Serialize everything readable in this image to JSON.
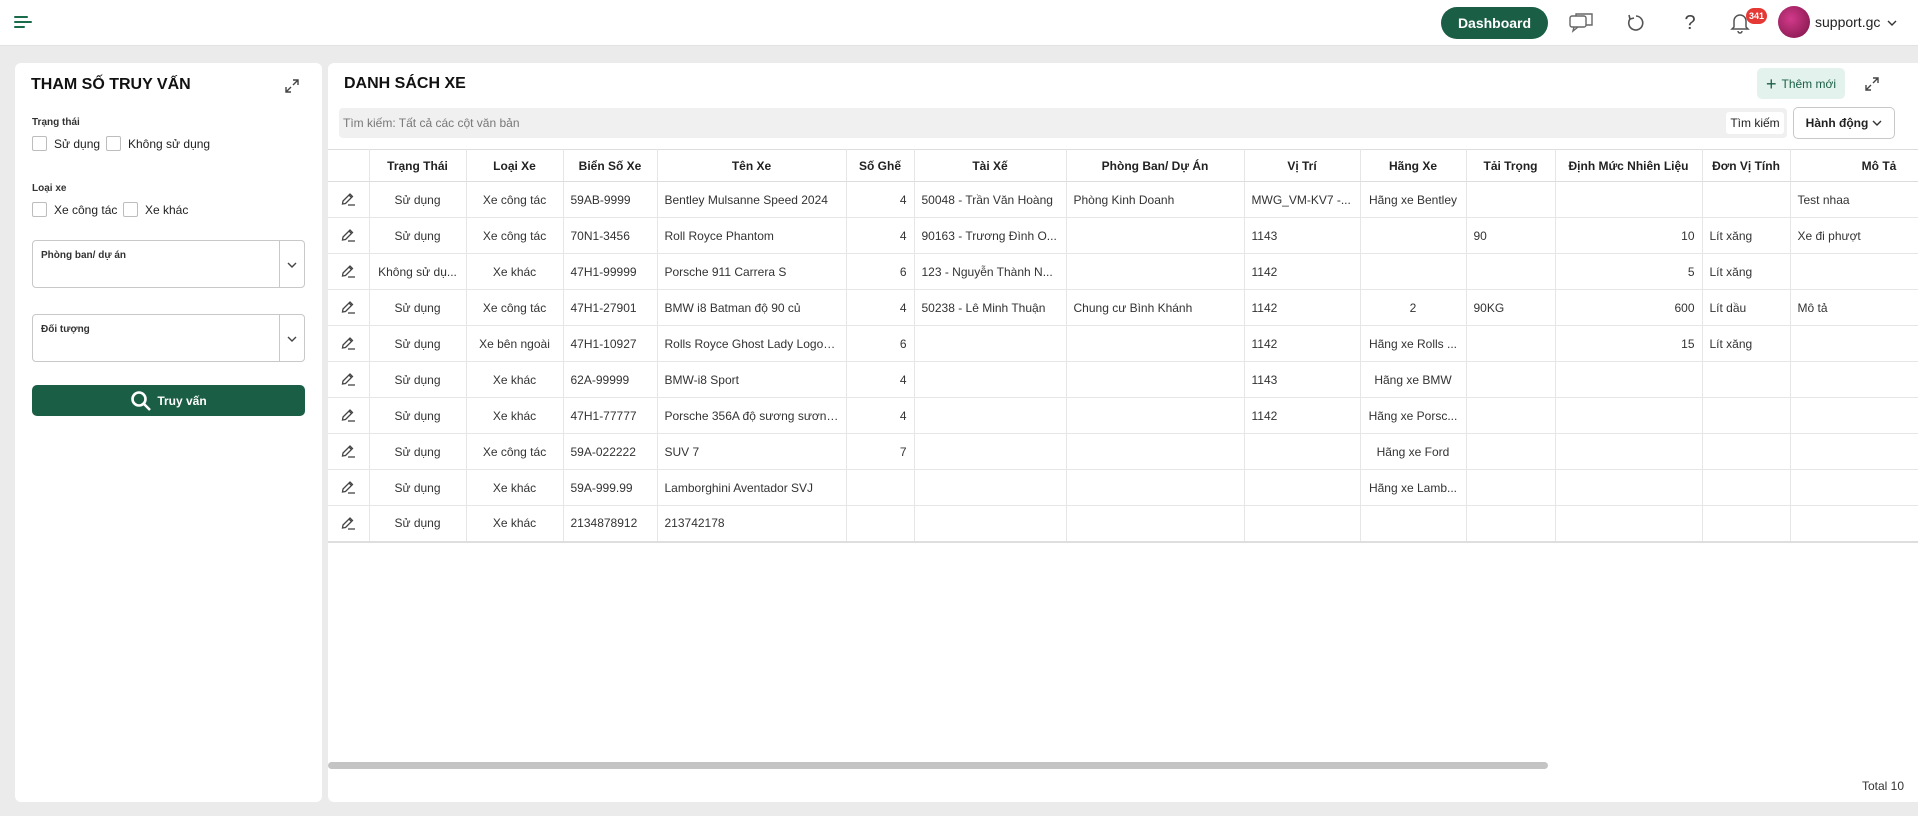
{
  "topbar": {
    "dashboard_label": "Dashboard",
    "notification_count": "341",
    "user_name": "support.gc"
  },
  "query_panel": {
    "title": "THAM SỐ TRUY VẤN",
    "status_label": "Trạng thái",
    "status_options": [
      "Sử dụng",
      "Không sử dụng"
    ],
    "type_label": "Loại xe",
    "type_options": [
      "Xe công tác",
      "Xe khác"
    ],
    "department_label": "Phòng ban/ dự án",
    "object_label": "Đối tượng",
    "query_button": "Truy vấn"
  },
  "list_panel": {
    "title": "DANH SÁCH XE",
    "add_button": "Thêm mới",
    "search_placeholder": "Tìm kiếm: Tất cả các cột văn bản",
    "search_button": "Tìm kiếm",
    "action_button": "Hành động",
    "total_label": "Total 10"
  },
  "table": {
    "columns": [
      "",
      "Trạng Thái",
      "Loại Xe",
      "Biển Số Xe",
      "Tên Xe",
      "Số Ghế",
      "Tài Xế",
      "Phòng Ban/ Dự Án",
      "Vị Trí",
      "Hãng Xe",
      "Tải Trọng",
      "Định Mức Nhiên Liệu",
      "Đơn Vị Tính",
      "Mô Tả"
    ],
    "rows": [
      [
        "Sử dụng",
        "Xe công tác",
        "59AB-9999",
        "Bentley Mulsanne Speed 2024",
        "4",
        "50048 - Trần Văn Hoàng",
        "Phòng Kinh Doanh",
        "MWG_VM-KV7 -...",
        "Hãng xe Bentley",
        "",
        "",
        "",
        "Test nhaa"
      ],
      [
        "Sử dụng",
        "Xe công tác",
        "70N1-3456",
        "Roll Royce Phantom",
        "4",
        "90163 - Trương Đình O...",
        "",
        "1143",
        "",
        "90",
        "10",
        "Lít xăng",
        "Xe đi phượt"
      ],
      [
        "Không sử dụ...",
        "Xe khác",
        "47H1-99999",
        "Porsche 911 Carrera S",
        "6",
        "123 - Nguyễn Thành N...",
        "",
        "1142",
        "",
        "",
        "5",
        "Lít xăng",
        ""
      ],
      [
        "Sử dụng",
        "Xe công tác",
        "47H1-27901",
        "BMW i8 Batman độ 90 củ",
        "4",
        "50238 - Lê Minh Thuận",
        "Chung cư Bình Khánh",
        "1142",
        "2",
        "90KG",
        "600",
        "Lít dầu",
        "Mô tả"
      ],
      [
        "Sử dụng",
        "Xe bên ngoài",
        "47H1-10927",
        "Rolls Royce Ghost Lady Logo Li...",
        "6",
        "",
        "",
        "1142",
        "Hãng xe Rolls ...",
        "",
        "15",
        "Lít xăng",
        ""
      ],
      [
        "Sử dụng",
        "Xe khác",
        "62A-99999",
        "BMW-i8 Sport",
        "4",
        "",
        "",
        "1143",
        "Hãng xe BMW",
        "",
        "",
        "",
        ""
      ],
      [
        "Sử dụng",
        "Xe khác",
        "47H1-77777",
        "Porsche 356A độ sương sương...",
        "4",
        "",
        "",
        "1142",
        "Hãng xe Porsc...",
        "",
        "",
        "",
        ""
      ],
      [
        "Sử dụng",
        "Xe công tác",
        "59A-022222",
        "SUV 7",
        "7",
        "",
        "",
        "",
        "Hãng xe Ford",
        "",
        "",
        "",
        ""
      ],
      [
        "Sử dụng",
        "Xe khác",
        "59A-999.99",
        "Lamborghini Aventador SVJ",
        "",
        "",
        "",
        "",
        "Hãng xe Lamb...",
        "",
        "",
        "",
        ""
      ],
      [
        "Sử dụng",
        "Xe khác",
        "2134878912",
        "213742178",
        "",
        "",
        "",
        "",
        "",
        "",
        "",
        "",
        ""
      ]
    ]
  },
  "colors": {
    "accent": "#1a5e45",
    "accent_light": "#e3f2ec",
    "badge": "#e53935",
    "page_bg": "#ebebeb"
  },
  "icons": [
    "menu-icon",
    "chat-icon",
    "refresh-icon",
    "help-icon",
    "bell-icon",
    "chevron-down-icon",
    "expand-icon",
    "search-icon",
    "plus-icon",
    "edit-icon"
  ]
}
